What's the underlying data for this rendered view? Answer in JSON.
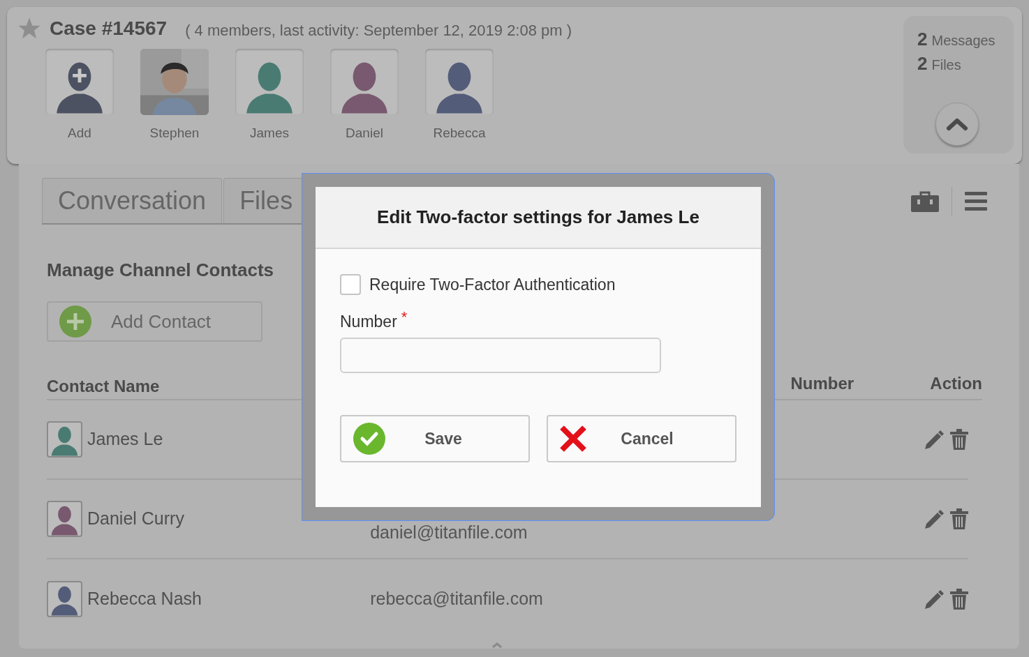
{
  "case": {
    "starred": false,
    "title": "Case #14567",
    "summary": "( 4 members, last activity: September 12, 2019 2:08 pm )"
  },
  "members": [
    {
      "name": "Add",
      "kind": "add",
      "color": "#4c5262"
    },
    {
      "name": "Stephen",
      "kind": "picture"
    },
    {
      "name": "James",
      "kind": "silhouette",
      "color": "#4a7b72"
    },
    {
      "name": "Daniel",
      "kind": "silhouette",
      "color": "#78596f"
    },
    {
      "name": "Rebecca",
      "kind": "silhouette",
      "color": "#535c78"
    }
  ],
  "stats": [
    {
      "count": "2",
      "label": "Messages"
    },
    {
      "count": "2",
      "label": "Files"
    }
  ],
  "tabs": [
    {
      "label": "Conversation",
      "selected": false
    },
    {
      "label": "Files",
      "selected": false
    }
  ],
  "section": {
    "title": "Manage Channel Contacts",
    "add_button": "Add Contact"
  },
  "table": {
    "columns": [
      "Contact Name",
      "Number",
      "Action"
    ],
    "rows": [
      {
        "name": "James Le",
        "color": "#4a7b72"
      },
      {
        "name": "Daniel Curry",
        "email": "daniel@titanfile.com",
        "color": "#78596f"
      },
      {
        "name": "Rebecca Nash",
        "email": "rebecca@titanfile.com",
        "color": "#535c78"
      }
    ]
  },
  "dialog": {
    "title": "Edit Two-factor settings for James Le",
    "checkbox": {
      "label": "Require Two-Factor Authentication",
      "checked": false
    },
    "field": {
      "label": "Number",
      "required": true,
      "required_mark": "*"
    },
    "buttons": [
      {
        "label": "Save",
        "kind": "confirm"
      },
      {
        "label": "Cancel",
        "kind": "cancel"
      }
    ]
  }
}
